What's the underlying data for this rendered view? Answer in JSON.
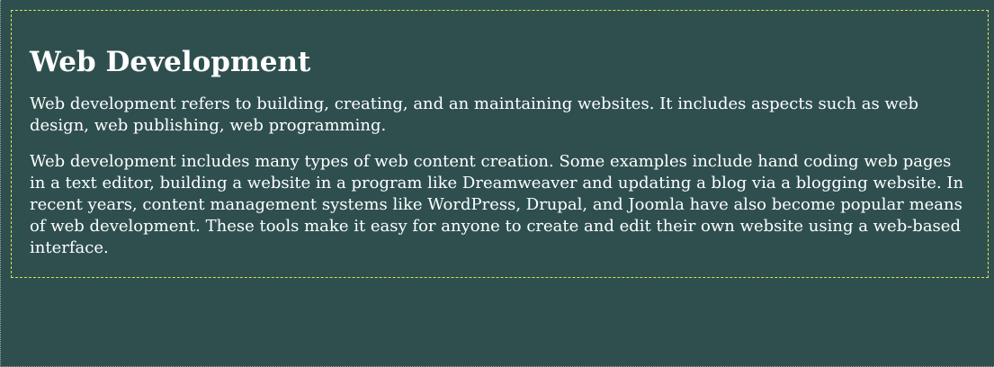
{
  "colors": {
    "background": "#2f4f4f",
    "text": "#ffffff",
    "box_border": "#d7e34a"
  },
  "section": {
    "heading": "Web Development",
    "paragraph_1": "Web development refers to building, creating, and an maintaining websites. It includes aspects such as web design, web publishing, web programming.",
    "paragraph_2": "Web development includes many types of web content creation. Some examples include hand coding web pages in a text editor, building a website in a program like Dreamweaver and updating a blog via a blogging website. In recent years, content management systems like WordPress, Drupal, and Joomla have also become popular means of web development. These tools make it easy for anyone to create and edit their own website using a web-based interface."
  }
}
